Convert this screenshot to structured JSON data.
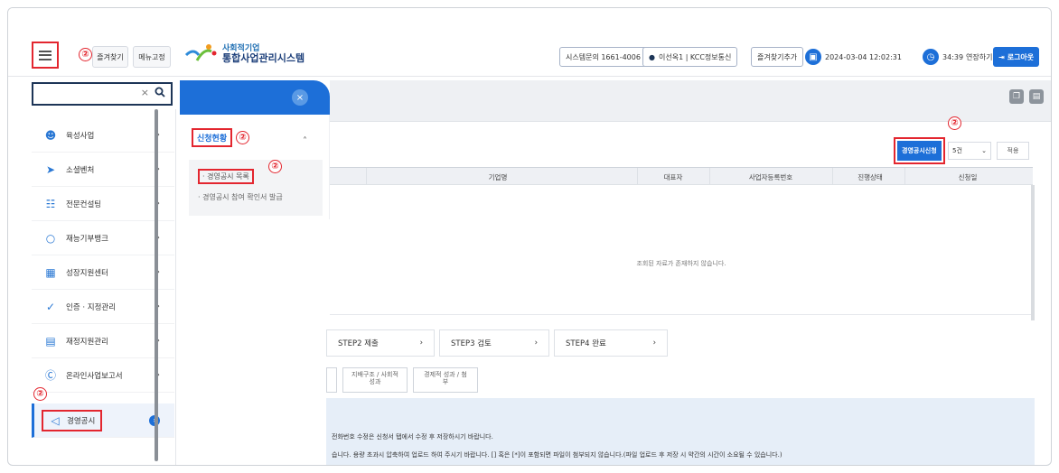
{
  "header": {
    "bookmark_label": "즐겨찾기",
    "menu_fix_label": "메뉴고정",
    "logo_line1": "사회적기업",
    "logo_line2": "통합사업관리시스템",
    "helpdesk": "시스템문의 1661-4006",
    "user_label": "이선옥1 | KCC정보통신",
    "add_bookmark_label": "즐겨찾기추가",
    "datetime": "2024-03-04 12:02:31",
    "timer": "34:39",
    "extend_label": "연장하기",
    "logout_label": "로그아웃"
  },
  "annotation": "②",
  "search": {
    "placeholder": "",
    "clear": "×"
  },
  "sidebar": {
    "items": [
      {
        "label": "육성사업",
        "icon": "people-icon"
      },
      {
        "label": "소셜벤처",
        "icon": "rocket-icon"
      },
      {
        "label": "전문컨설팅",
        "icon": "consulting-icon"
      },
      {
        "label": "재능기부뱅크",
        "icon": "lightbulb-icon"
      },
      {
        "label": "성장지원센터",
        "icon": "building-icon"
      },
      {
        "label": "인증 · 지정관리",
        "icon": "shield-check-icon"
      },
      {
        "label": "재정지원관리",
        "icon": "finance-icon"
      },
      {
        "label": "온라인사업보고서",
        "icon": "report-icon"
      },
      {
        "label": "경영공시",
        "icon": "megaphone-icon"
      }
    ]
  },
  "submenu": {
    "section_label": "신청현황",
    "items": [
      "경영공시 목록",
      "경영공시 참여 확인서 발급"
    ]
  },
  "main": {
    "apply_button_label": "경영공시신청",
    "page_size": "5건",
    "apply_label": "적용",
    "columns": [
      "기업명",
      "대표자",
      "사업자등록번호",
      "진행상태",
      "신청일"
    ],
    "empty_message": "조회된 자료가 존재하지 않습니다.",
    "steps": [
      "STEP2 제출",
      "STEP3 검토",
      "STEP4 완료"
    ],
    "tabs": [
      "지배구조 / 사회적 성과",
      "경제적 성과 / 첨부"
    ],
    "notes": [
      "전화번호 수정은 신청서 탭에서 수정 후 저장하시기 바랍니다.",
      "습니다. 용량 초과시 압축하여 업로드 하여 주시기 바랍니다. [] 혹은 [*]이 포함되면 파일이 첨부되지 않습니다.(파일 업로드 후 저장 시 약간의 시간이 소요될 수 있습니다.)"
    ]
  },
  "colors": {
    "primary": "#1d6fd8",
    "highlight": "#e3262f",
    "navy": "#1d3557"
  }
}
